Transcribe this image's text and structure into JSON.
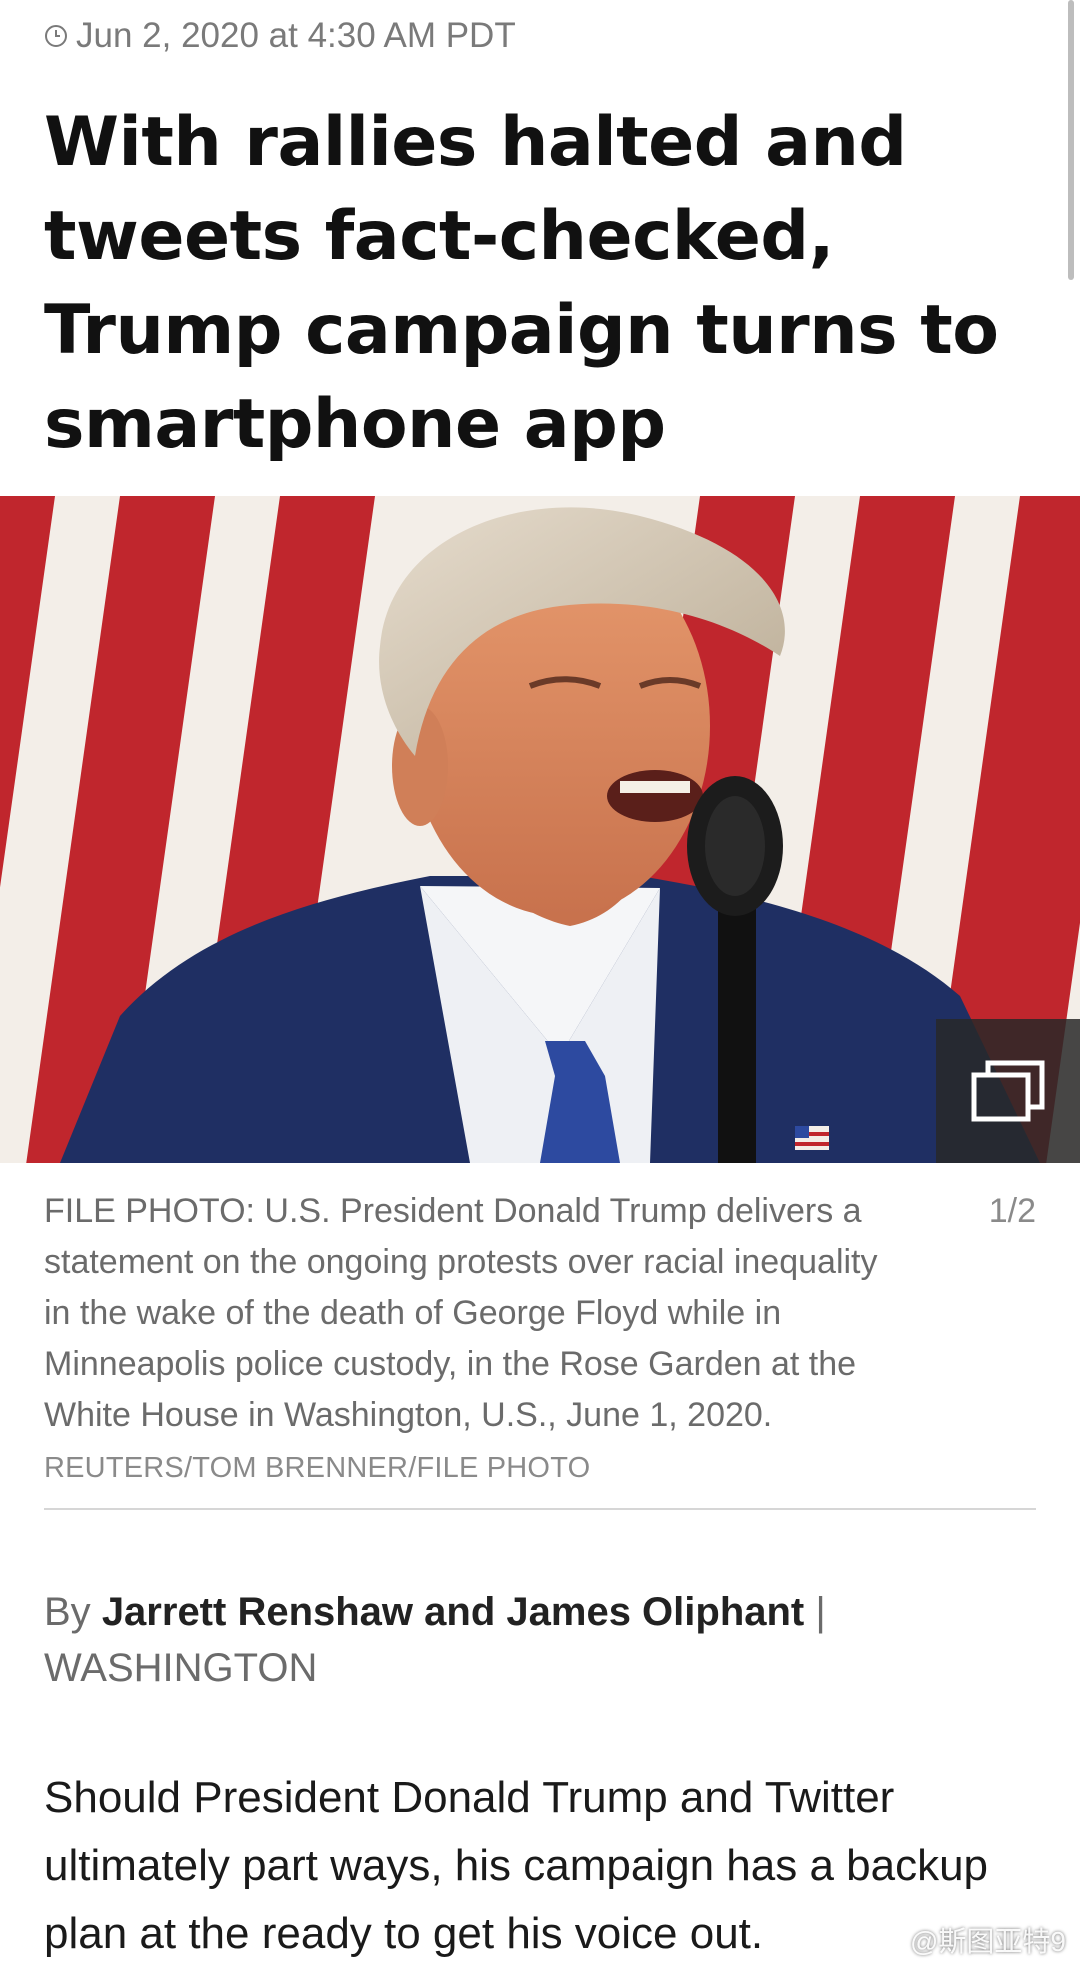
{
  "article": {
    "timestamp": "Jun 2, 2020 at 4:30 AM PDT",
    "headline": "With rallies halted and tweets fact-checked, Trump campaign turns to smartphone app",
    "photo": {
      "caption": "FILE PHOTO: U.S. President Donald Trump delivers a statement on the ongoing protests over racial inequality in the wake of the death of George Floyd while in Minneapolis police custody, in the Rose Garden at the White House in Washington, U.S., June 1, 2020.",
      "credit": "REUTERS/TOM BRENNER/FILE PHOTO",
      "counter": "1/2"
    },
    "byline": {
      "prefix": "By",
      "authors": "Jarrett Renshaw and James Oliphant",
      "separator": "|",
      "location": "WASHINGTON"
    },
    "lead": "Should President Donald Trump and Twitter ultimately part ways, his campaign has a backup plan at the ready to get his voice out."
  },
  "watermark": {
    "text": "@斯图亚特9",
    "icon": "weibo-logo-icon"
  },
  "colors": {
    "flag_red": "#c0262d",
    "flag_white": "#f3eee8",
    "suit_navy": "#1f2f63",
    "tie_blue": "#2d4aa0",
    "text_gray": "#6b6b6b"
  }
}
